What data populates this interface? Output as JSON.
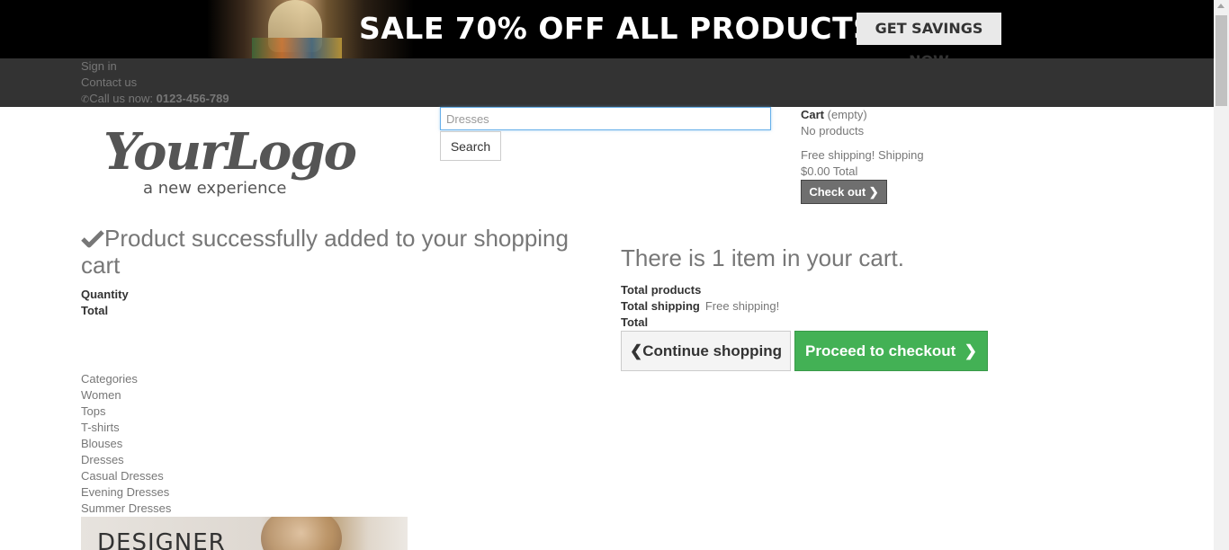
{
  "banner": {
    "headline": "SALE 70% OFF ALL PRODUCTS",
    "button_label": "GET SAVINGS NOW"
  },
  "topnav": {
    "sign_in": "Sign in",
    "contact": "Contact us",
    "call_label": "Call us now: ",
    "phone": "0123-456-789"
  },
  "logo": {
    "main": "YourLogo",
    "tagline": "a new experience"
  },
  "search": {
    "value": "Dresses",
    "button_label": "Search"
  },
  "cart": {
    "title": "Cart",
    "status": " (empty)",
    "no_products": "No products",
    "shipping_line": "Free shipping! Shipping",
    "total_line": "$0.00 Total",
    "checkout_label": "Check out"
  },
  "layer_cart": {
    "added_message": "Product successfully added to your shopping cart",
    "quantity_label": "Quantity",
    "total_label": "Total",
    "items_message": "There is 1 item in your cart.",
    "total_products_label": "Total products",
    "total_shipping_label": "Total shipping",
    "total_shipping_value": "Free shipping!",
    "grand_total_label": "Total",
    "continue_label": "Continue shopping",
    "proceed_label": "Proceed to checkout"
  },
  "categories": {
    "heading": "Categories",
    "items": [
      "Women",
      "Tops",
      "T-shirts",
      "Blouses",
      "Dresses",
      "Casual Dresses",
      "Evening Dresses",
      "Summer Dresses"
    ]
  },
  "promo": {
    "text": "DESIGNER"
  },
  "colors": {
    "banner_bg": "#000000",
    "nav_bg": "#333333",
    "proceed_green": "#43b155",
    "checkout_gray": "#6f6f6f"
  }
}
